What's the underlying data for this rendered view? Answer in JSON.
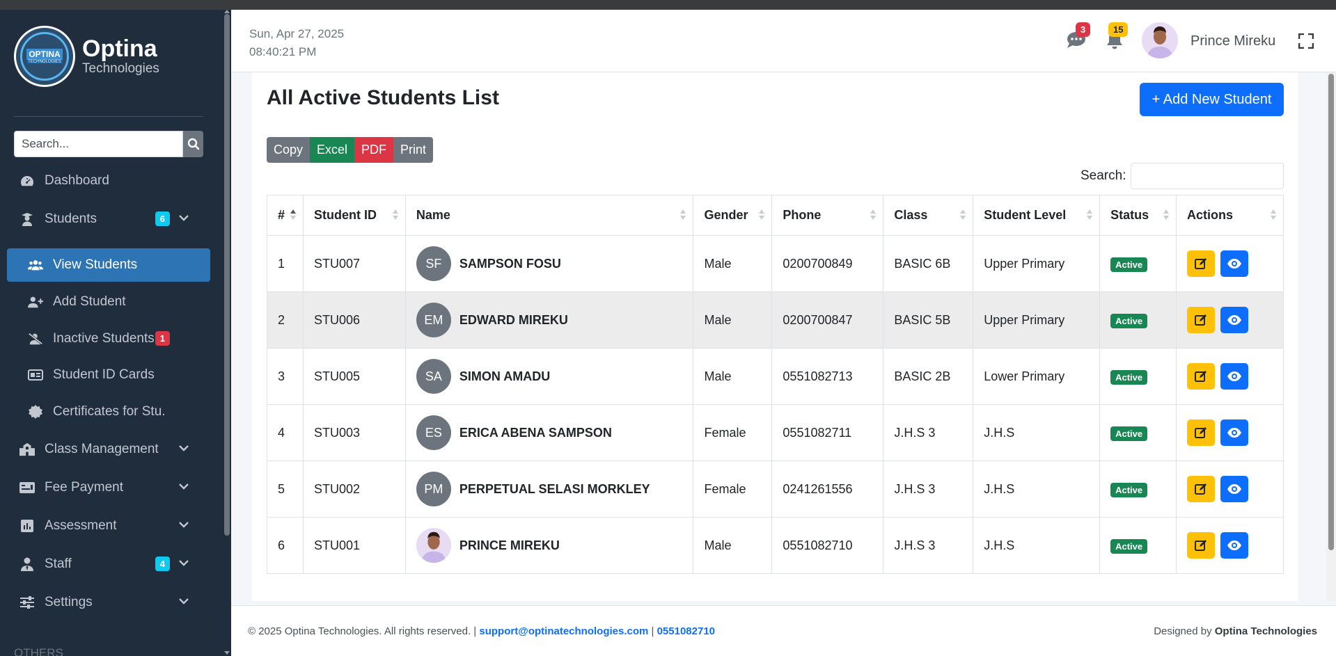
{
  "brand": {
    "name": "Optina",
    "sub": "Technologies",
    "logo_text": "OPTINA",
    "logo_sub": "TECHNOLOGIES"
  },
  "sidebar": {
    "search_placeholder": "Search...",
    "items": [
      {
        "label": "Dashboard"
      },
      {
        "label": "Students",
        "badge": "6"
      },
      {
        "label": "View Students"
      },
      {
        "label": "Add Student"
      },
      {
        "label": "Inactive Students",
        "badge": "1"
      },
      {
        "label": "Student ID Cards"
      },
      {
        "label": "Certificates for Stu."
      },
      {
        "label": "Class Management"
      },
      {
        "label": "Fee Payment"
      },
      {
        "label": "Assessment"
      },
      {
        "label": "Staff",
        "badge": "4"
      },
      {
        "label": "Settings"
      }
    ],
    "section_others": "OTHERS"
  },
  "header": {
    "date": "Sun, Apr 27, 2025",
    "time": "08:40:21 PM",
    "messages_count": "3",
    "notifications_count": "15",
    "user_name": "Prince Mireku"
  },
  "main": {
    "title": "All Active Students List",
    "add_button": "+ Add New Student",
    "export": {
      "copy": "Copy",
      "excel": "Excel",
      "pdf": "PDF",
      "print": "Print"
    },
    "search_label": "Search:",
    "columns": [
      "#",
      "Student ID",
      "Name",
      "Gender",
      "Phone",
      "Class",
      "Student Level",
      "Status",
      "Actions"
    ],
    "rows": [
      {
        "n": "1",
        "id": "STU007",
        "initials": "SF",
        "name": "SAMPSON FOSU",
        "gender": "Male",
        "phone": "0200700849",
        "class": "BASIC 6B",
        "level": "Upper Primary",
        "status": "Active"
      },
      {
        "n": "2",
        "id": "STU006",
        "initials": "EM",
        "name": "EDWARD MIREKU",
        "gender": "Male",
        "phone": "0200700847",
        "class": "BASIC 5B",
        "level": "Upper Primary",
        "status": "Active"
      },
      {
        "n": "3",
        "id": "STU005",
        "initials": "SA",
        "name": "SIMON AMADU",
        "gender": "Male",
        "phone": "0551082713",
        "class": "BASIC 2B",
        "level": "Lower Primary",
        "status": "Active"
      },
      {
        "n": "4",
        "id": "STU003",
        "initials": "ES",
        "name": "ERICA ABENA SAMPSON",
        "gender": "Female",
        "phone": "0551082711",
        "class": "J.H.S 3",
        "level": "J.H.S",
        "status": "Active"
      },
      {
        "n": "5",
        "id": "STU002",
        "initials": "PM",
        "name": "PERPETUAL SELASI MORKLEY",
        "gender": "Female",
        "phone": "0241261556",
        "class": "J.H.S 3",
        "level": "J.H.S",
        "status": "Active"
      },
      {
        "n": "6",
        "id": "STU001",
        "initials": "",
        "name": "PRINCE MIREKU",
        "gender": "Male",
        "phone": "0551082710",
        "class": "J.H.S 3",
        "level": "J.H.S",
        "status": "Active"
      }
    ]
  },
  "footer": {
    "copyright": "© 2025 Optina Technologies. All rights reserved. |",
    "email": "support@optinatechnologies.com",
    "sep": "|",
    "phone": "0551082710",
    "designed_by_label": "Designed by",
    "designed_by": "Optina Technologies"
  },
  "colors": {
    "sidebar_bg": "#1f2d3d",
    "active_nav": "#2c74b3",
    "primary": "#0d6efd",
    "success": "#198754",
    "danger": "#dc3545",
    "warning": "#ffc107",
    "info": "#0dcaf0"
  }
}
